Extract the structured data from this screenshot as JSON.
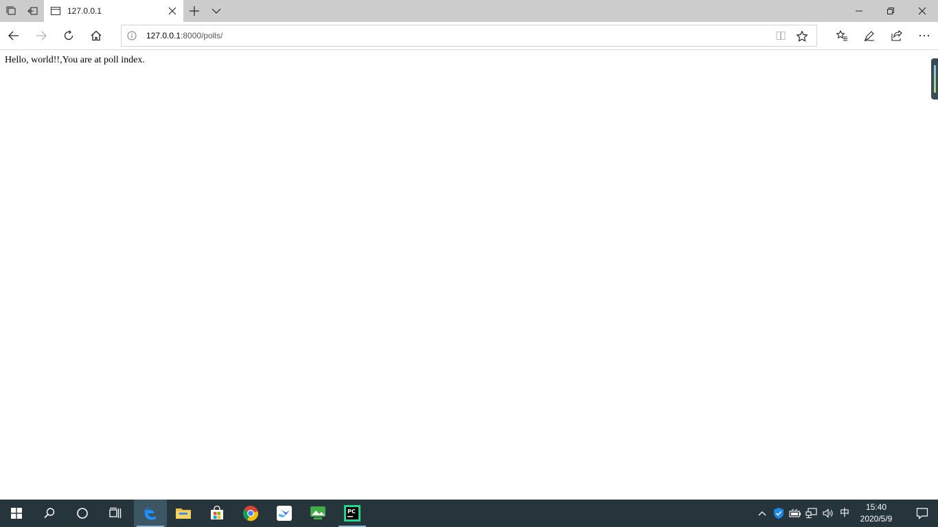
{
  "browser": {
    "tab": {
      "title": "127.0.0.1"
    },
    "address_bar": {
      "host": "127.0.0.1",
      "path": ":8000/polls/"
    }
  },
  "page": {
    "text": "Hello, world!!,You are at poll index."
  },
  "taskbar": {
    "apps": [
      "windows-start",
      "search",
      "cortana",
      "task-view",
      "edge",
      "file-explorer",
      "microsoft-store",
      "chrome",
      "feishu",
      "photos",
      "pycharm"
    ],
    "active_app": "edge",
    "tray": {
      "ime": "中",
      "time": "15:40",
      "date": "2020/5/9"
    }
  },
  "colors": {
    "tabstrip": "#cccccc",
    "taskbar": "#26343c",
    "taskbar_active": "#3d5663",
    "edge_blue": "#0078d7"
  }
}
